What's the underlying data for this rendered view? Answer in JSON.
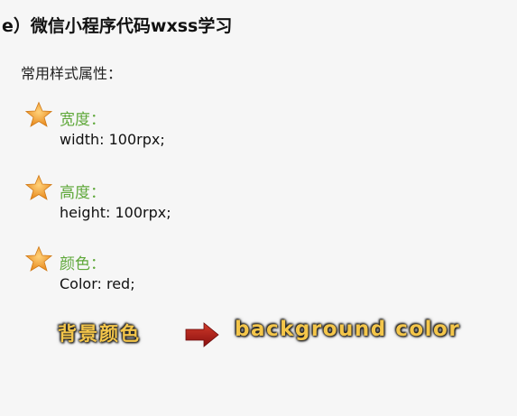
{
  "header": {
    "title": "e）微信小程序代码wxss学习"
  },
  "section": {
    "subtitle": "常用样式属性："
  },
  "properties": [
    {
      "label": "宽度：",
      "value": "width: 100rpx;",
      "icon": "star-icon"
    },
    {
      "label": "高度：",
      "value": "height: 100rpx;",
      "icon": "star-icon"
    },
    {
      "label": "颜色：",
      "value": "Color: red;",
      "icon": "star-icon"
    }
  ],
  "translation": {
    "chinese": "背景颜色",
    "english": "background color",
    "icon": "arrow-right-icon"
  },
  "colors": {
    "label_green": "#5fa83a",
    "star_orange": "#f0a030",
    "glow_yellow": "#f4c64a",
    "arrow_red": "#a01818"
  }
}
